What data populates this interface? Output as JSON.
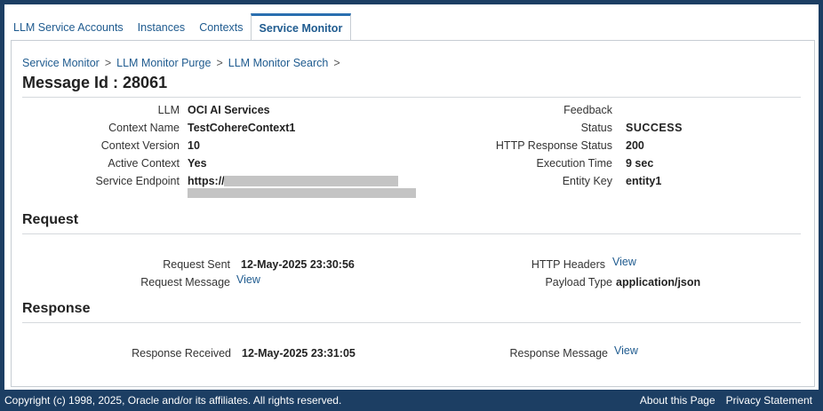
{
  "tabs": [
    {
      "label": "LLM Service Accounts"
    },
    {
      "label": "Instances"
    },
    {
      "label": "Contexts"
    },
    {
      "label": "Service Monitor"
    }
  ],
  "breadcrumbs": [
    "Service Monitor",
    "LLM Monitor Purge",
    "LLM Monitor Search"
  ],
  "breadcrumb_sep": ">",
  "page_title": "Message Id : 28061",
  "details_left": [
    {
      "label": "LLM",
      "value": "OCI AI Services"
    },
    {
      "label": "Context Name",
      "value": "TestCohereContext1"
    },
    {
      "label": "Context Version",
      "value": "10"
    },
    {
      "label": "Active Context",
      "value": "Yes"
    },
    {
      "label": "Service Endpoint",
      "value": "https://"
    }
  ],
  "details_right": [
    {
      "label": "Feedback",
      "value": ""
    },
    {
      "label": "Status",
      "value": "SUCCESS"
    },
    {
      "label": "HTTP Response Status",
      "value": "200"
    },
    {
      "label": "Execution Time",
      "value": "9 sec"
    },
    {
      "label": "Entity Key",
      "value": "entity1"
    }
  ],
  "request": {
    "heading": "Request",
    "sent_label": "Request Sent",
    "sent_value": "12-May-2025 23:30:56",
    "message_label": "Request Message",
    "message_link": "View",
    "headers_label": "HTTP Headers",
    "headers_link": "View",
    "payload_label": "Payload Type",
    "payload_value": "application/json"
  },
  "response": {
    "heading": "Response",
    "received_label": "Response Received",
    "received_value": "12-May-2025 23:31:05",
    "message_label": "Response Message",
    "message_link": "View"
  },
  "footer": {
    "copyright": "Copyright (c) 1998, 2025, Oracle and/or its affiliates. All rights reserved.",
    "about": "About this Page",
    "privacy": "Privacy Statement"
  },
  "colors": {
    "header_bg": "#1c3e63",
    "link": "#1f5b8f",
    "active_tab_top": "#2a6fb0"
  }
}
